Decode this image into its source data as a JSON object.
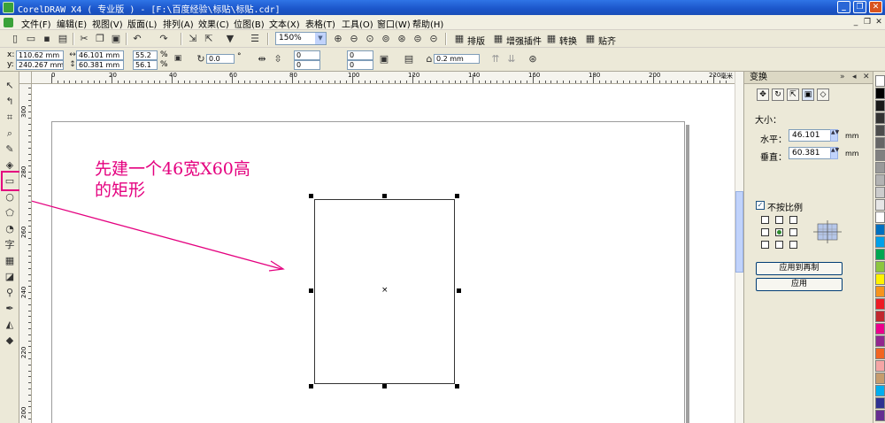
{
  "window": {
    "title": "CorelDRAW X4 ( 专业版 ) - [F:\\百度经验\\标贴\\标贴.cdr]",
    "controls": [
      "_",
      "❐",
      "✕"
    ]
  },
  "menu": {
    "items": [
      "文件(F)",
      "编辑(E)",
      "视图(V)",
      "版面(L)",
      "排列(A)",
      "效果(C)",
      "位图(B)",
      "文本(X)",
      "表格(T)",
      "工具(O)",
      "窗口(W)",
      "帮助(H)"
    ],
    "mdi_controls": [
      "_",
      "❐",
      "✕"
    ]
  },
  "toolbar": {
    "zoom": "150%",
    "plugins": [
      "排版",
      "增强插件",
      "转换",
      "贴齐"
    ]
  },
  "property_bar": {
    "x_label": "x:",
    "x_value": "110.62 mm",
    "y_label": "y:",
    "y_value": "240.267 mm",
    "width_value": "46.101 mm",
    "height_value": "60.381 mm",
    "scale_w": "55.2",
    "scale_h": "56.1",
    "percent": "%",
    "rotation": "0.0",
    "degree": "°",
    "corner_values": [
      "0",
      "0",
      "0",
      "0"
    ],
    "outline_width": "0.2 mm"
  },
  "ruler": {
    "h_labels": [
      "0",
      "20",
      "40",
      "60",
      "80",
      "100",
      "120",
      "140",
      "160",
      "180",
      "200",
      "220"
    ],
    "h_unit": "毫米",
    "v_labels": [
      "300",
      "280",
      "260",
      "240",
      "220",
      "200"
    ]
  },
  "annotation": {
    "line1": "先建一个46宽X60高",
    "line2": "的矩形"
  },
  "docker": {
    "title": "变换",
    "head_buttons": [
      "»",
      "◂",
      "✕"
    ],
    "tab_icons": [
      "position-icon",
      "rotate-icon",
      "scale-icon",
      "size-icon",
      "skew-icon"
    ],
    "section_label": "大小：",
    "horizontal_label": "水平：",
    "horizontal_value": "46.101",
    "vertical_label": "垂直：",
    "vertical_value": "60.381",
    "unit": "mm",
    "proportional_label": "不按比例",
    "proportional_checked": true,
    "apply_duplicate_label": "应用到再制",
    "apply_label": "应用"
  },
  "palette": {
    "colors": [
      "#ffffff",
      "#000000",
      "#1a1a1a",
      "#333333",
      "#4d4d4d",
      "#666666",
      "#808080",
      "#999999",
      "#b3b3b3",
      "#cccccc",
      "#e6e6e6",
      "#ffffff",
      "#0070c0",
      "#00a0e9",
      "#00a651",
      "#8dc63f",
      "#fff200",
      "#f7941d",
      "#ed1c24",
      "#c1272d",
      "#ec008c",
      "#92278f",
      "#f26522",
      "#f5a5a5",
      "#c69c6d",
      "#00aeef",
      "#2e3192",
      "#662d91"
    ]
  },
  "colors": {
    "accent": "#e4007f",
    "titlebar": "#1b55c9"
  }
}
